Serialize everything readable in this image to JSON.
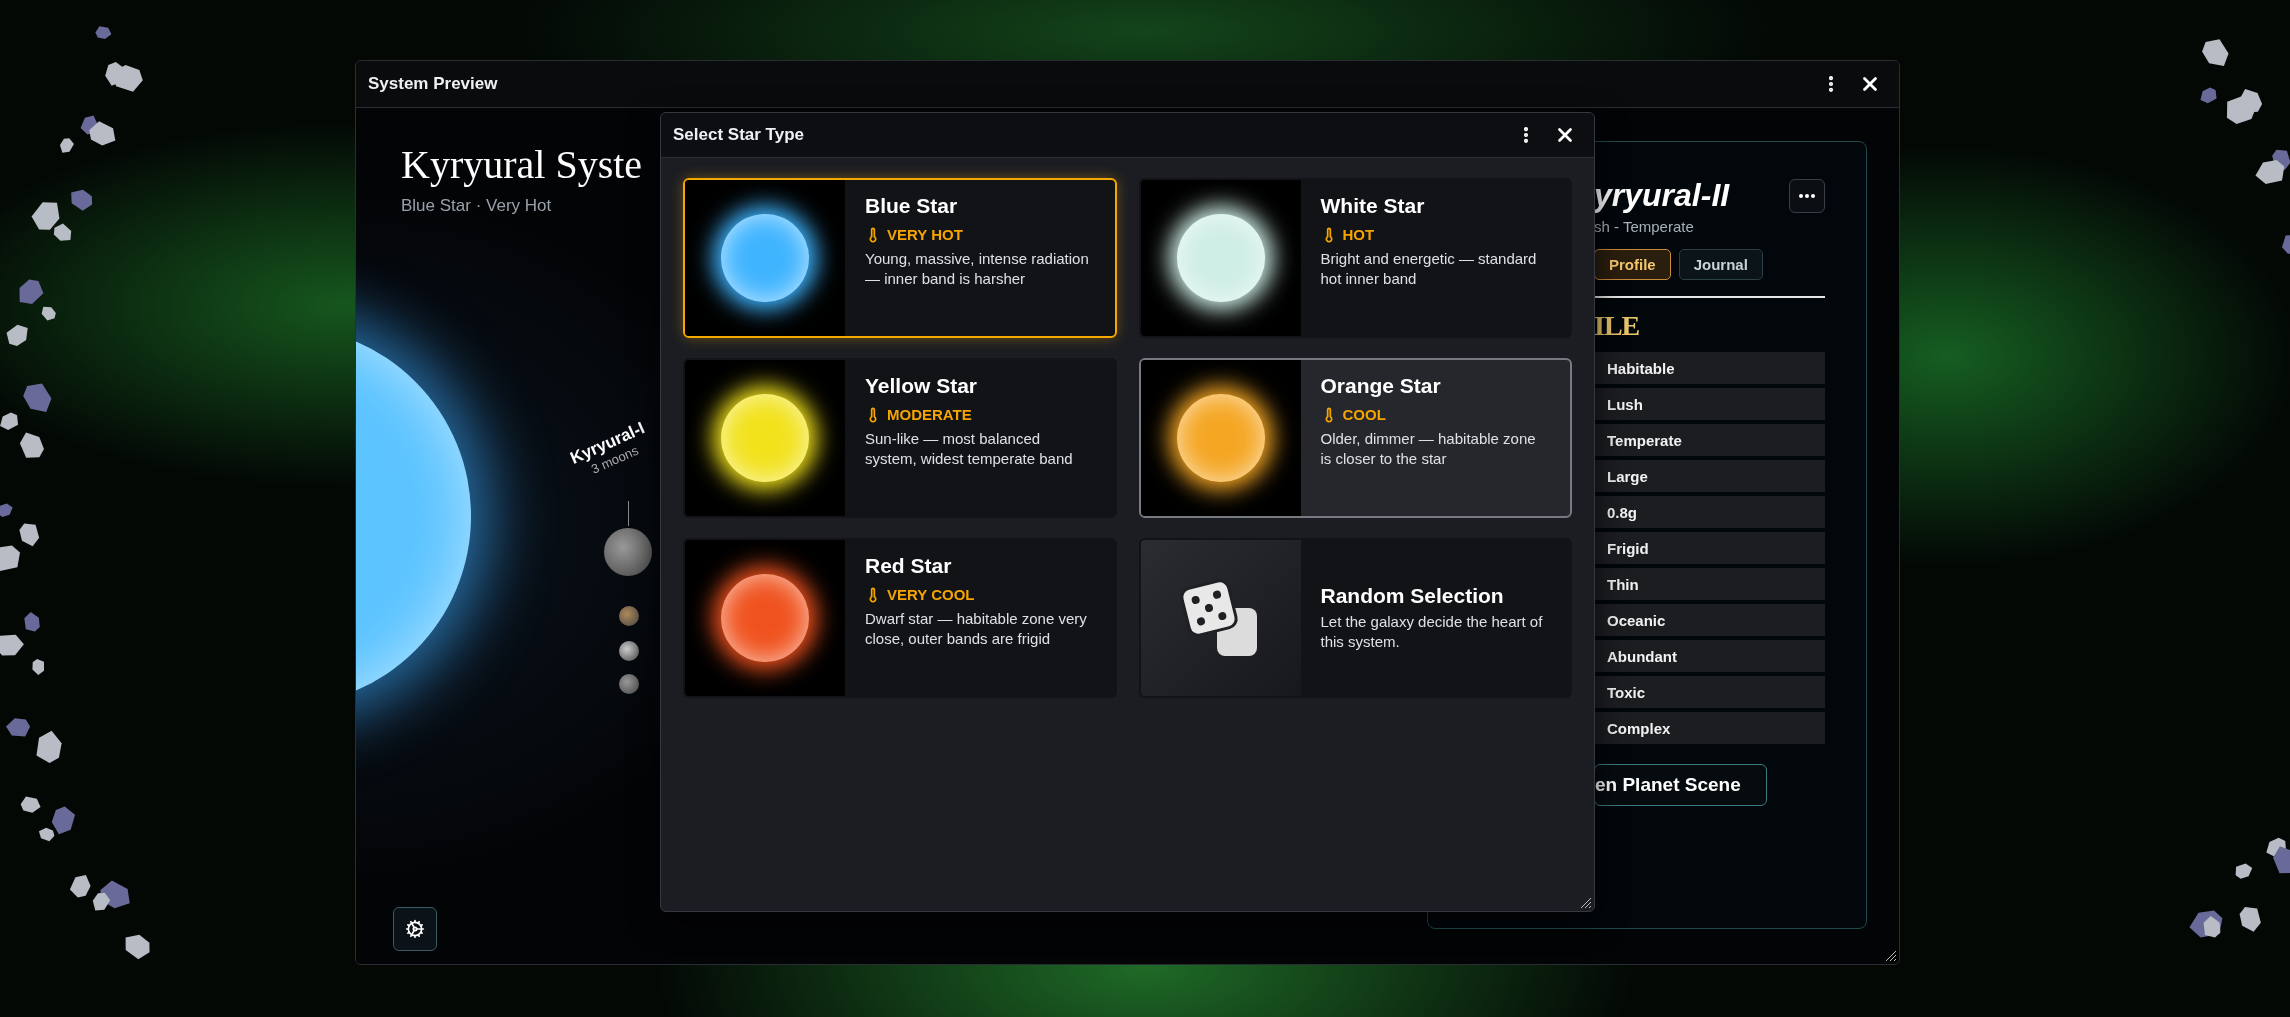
{
  "window": {
    "title": "System Preview"
  },
  "system": {
    "title": "Kyryural Syste",
    "subtitle": "Blue Star · Very Hot"
  },
  "planet_label": {
    "name": "Kyryural-I",
    "moons": "3 moons"
  },
  "dialog": {
    "title": "Select Star Type",
    "options": [
      {
        "kind": "star",
        "name": "Blue Star",
        "temperature": "VERY HOT",
        "description": "Young, massive, intense radiation — inner band is harsher",
        "color": "#3fb4ff",
        "selected": true,
        "hovered": false
      },
      {
        "kind": "star",
        "name": "White Star",
        "temperature": "HOT",
        "description": "Bright and energetic — standard hot inner band",
        "color": "#cfeee6",
        "selected": false,
        "hovered": false
      },
      {
        "kind": "star",
        "name": "Yellow Star",
        "temperature": "MODERATE",
        "description": "Sun-like — most balanced system, widest temperate band",
        "color": "#f2e21c",
        "selected": false,
        "hovered": false
      },
      {
        "kind": "star",
        "name": "Orange Star",
        "temperature": "COOL",
        "description": "Older, dimmer — habitable zone is closer to the star",
        "color": "#f5a623",
        "selected": false,
        "hovered": true
      },
      {
        "kind": "star",
        "name": "Red Star",
        "temperature": "VERY COOL",
        "description": "Dwarf star — habitable zone very close, outer bands are frigid",
        "color": "#f0521e",
        "selected": false,
        "hovered": false
      },
      {
        "kind": "random",
        "name": "Random Selection",
        "description": "Let the galaxy decide the heart of this system.",
        "selected": false,
        "hovered": false
      }
    ]
  },
  "planet_panel": {
    "title": "yryural-II",
    "subtitle": "sh - Temperate",
    "tabs": [
      {
        "label": "Profile",
        "selected": true
      },
      {
        "label": "Journal",
        "selected": false
      }
    ],
    "heading": "ILE",
    "traits": [
      "Habitable",
      "Lush",
      "Temperate",
      "Large",
      "0.8g",
      "Frigid",
      "Thin",
      "Oceanic",
      "Abundant",
      "Toxic",
      "Complex"
    ],
    "action": "en Planet Scene"
  }
}
